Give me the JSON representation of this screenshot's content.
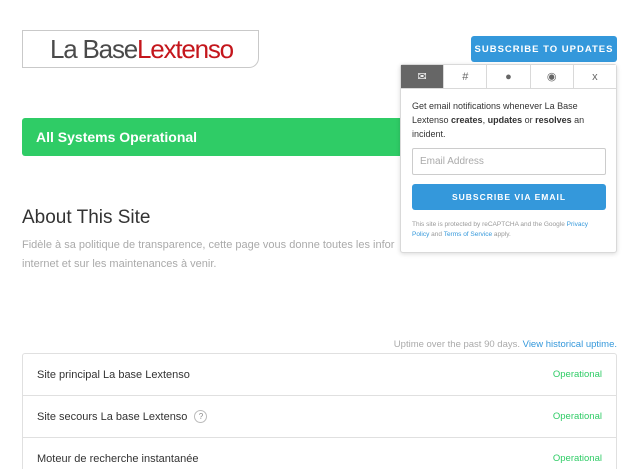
{
  "logo": {
    "part1": "La Base",
    "part2": "Lextenso"
  },
  "header": {
    "subscribe_label": "SUBSCRIBE TO UPDATES"
  },
  "status": {
    "text": "All Systems Operational"
  },
  "about": {
    "title": "About This Site",
    "text_line1": "Fidèle à sa politique de transparence, cette page vous donne toutes les infor",
    "text_line2": "internet et sur les maintenances à venir."
  },
  "uptime": {
    "note": "Uptime over the past 90 days.",
    "link": "View historical uptime."
  },
  "components": [
    {
      "name": "Site principal La base Lextenso",
      "status": "Operational",
      "help": false
    },
    {
      "name": "Site secours La base Lextenso",
      "status": "Operational",
      "help": true,
      "help_glyph": "?"
    },
    {
      "name": "Moteur de recherche instantanée",
      "status": "Operational",
      "help": false
    }
  ],
  "popup": {
    "tabs": [
      {
        "icon": "envelope-icon",
        "glyph": "✉",
        "active": true
      },
      {
        "icon": "slack-icon",
        "glyph": "#",
        "active": false
      },
      {
        "icon": "chat-bubble-icon",
        "glyph": "●",
        "active": false
      },
      {
        "icon": "rss-icon",
        "glyph": "◉",
        "active": false
      },
      {
        "icon": "close-icon",
        "glyph": "x",
        "active": false
      }
    ],
    "desc_part1": "Get email notifications whenever La Base Lextenso ",
    "desc_bold1": "creates",
    "desc_sep1": ", ",
    "desc_bold2": "updates",
    "desc_sep2": " or ",
    "desc_bold3": "resolves",
    "desc_part2": " an incident.",
    "email_placeholder": "Email Address",
    "email_button": "SUBSCRIBE VIA EMAIL",
    "recaptcha_text": "This site is protected by reCAPTCHA and the Google",
    "privacy_link": "Privacy Policy",
    "recaptcha_and": " and ",
    "terms_link": "Terms of Service",
    "recaptcha_end": " apply."
  },
  "colors": {
    "accent": "#3498db",
    "operational": "#2fcc66",
    "brand_red": "#c4161c"
  }
}
